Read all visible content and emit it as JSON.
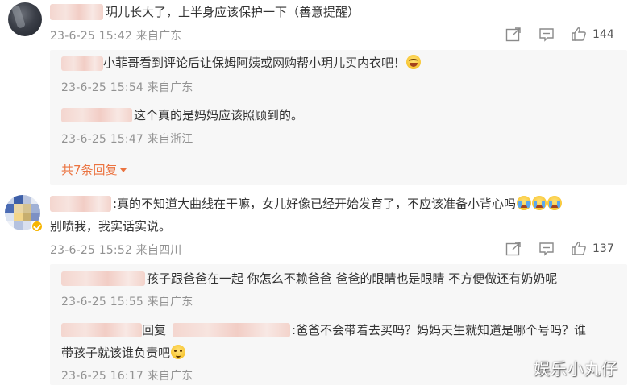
{
  "comments": [
    {
      "text": "玥儿长大了，上半身应该保护一下（善意提醒）",
      "time": "23-6-25 15:42 来自广东",
      "likes": "144",
      "replies": [
        {
          "text": "小菲哥看到评论后让保姆阿姨或网购帮小玥儿买内衣吧！",
          "emoji": "laughing-crying-emoji",
          "time": "23-6-25 15:54 来自广东"
        },
        {
          "text": "这个真的是妈妈应该照顾到的。",
          "time": "23-6-25 15:47 来自浙江"
        }
      ],
      "more_replies": "共7条回复"
    },
    {
      "text_line1": ":真的不知道大曲线在干嘛，女儿好像已经开始发育了，不应该准备小背心吗",
      "text_line2": "别喷我，我实话实说。",
      "emojis": [
        "crying-emoji",
        "crying-emoji",
        "crying-emoji"
      ],
      "time": "23-6-25 15:52 来自四川",
      "likes": "137",
      "replies": [
        {
          "text": "孩子跟爸爸在一起 你怎么不赖爸爸 爸爸的眼睛也是眼睛 不方便做还有奶奶呢",
          "time": "23-6-25 15:55 来自广东"
        },
        {
          "reply_word": "回复",
          "text_line1": ":爸爸不会带着去买吗？妈妈天生就知道是哪个号吗？谁",
          "text_line2": "带孩子就该谁负责吧",
          "emoji": "shy-emoji",
          "time": "23-6-25 16:17 来自广东"
        }
      ]
    }
  ],
  "watermark": "娱乐小丸仔",
  "colors": {
    "link": "#eb7340",
    "meta": "#929292",
    "text": "#333333",
    "reply_bg": "#f7f7f7"
  }
}
